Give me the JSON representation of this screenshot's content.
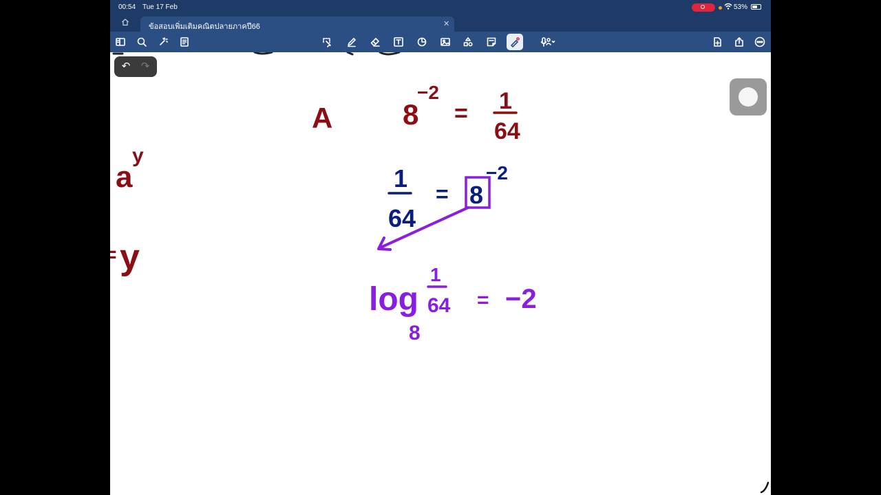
{
  "status": {
    "time": "00:54",
    "date": "Tue 17 Feb",
    "battery": "53%"
  },
  "tab": {
    "title": "ข้อสอบเพิ่มเติมคณิตปลายภาคปี66"
  },
  "toolbar": {
    "left_icons": [
      "sidebar-icon",
      "search-icon",
      "sparkle-icon",
      "document-icon"
    ],
    "center_icons": [
      "lasso-icon",
      "pen-icon",
      "eraser-icon",
      "text-box-icon",
      "shapes-icon",
      "image-icon",
      "elements-icon",
      "sticky-note-icon",
      "laser-pointer-icon",
      "microphone-icon"
    ],
    "right_icons": [
      "add-page-icon",
      "share-icon",
      "more-icon"
    ]
  },
  "handwriting": {
    "color_red": "#8b0e14",
    "color_navy": "#0a1f7d",
    "color_purple": "#8a1ee0",
    "line1": {
      "label": "A",
      "base": "8",
      "exp": "−2",
      "eq": "=",
      "num": "1",
      "den": "64"
    },
    "line2": {
      "num": "1",
      "den": "64",
      "eq": "=",
      "base": "8",
      "exp": "−2"
    },
    "line3": {
      "log": "log",
      "sub": "8",
      "num": "1",
      "den": "64",
      "eq": "=",
      "result": "−2"
    },
    "left_edge": {
      "a": "a",
      "a_exp": "y",
      "eq": "=",
      "y": "y"
    }
  }
}
